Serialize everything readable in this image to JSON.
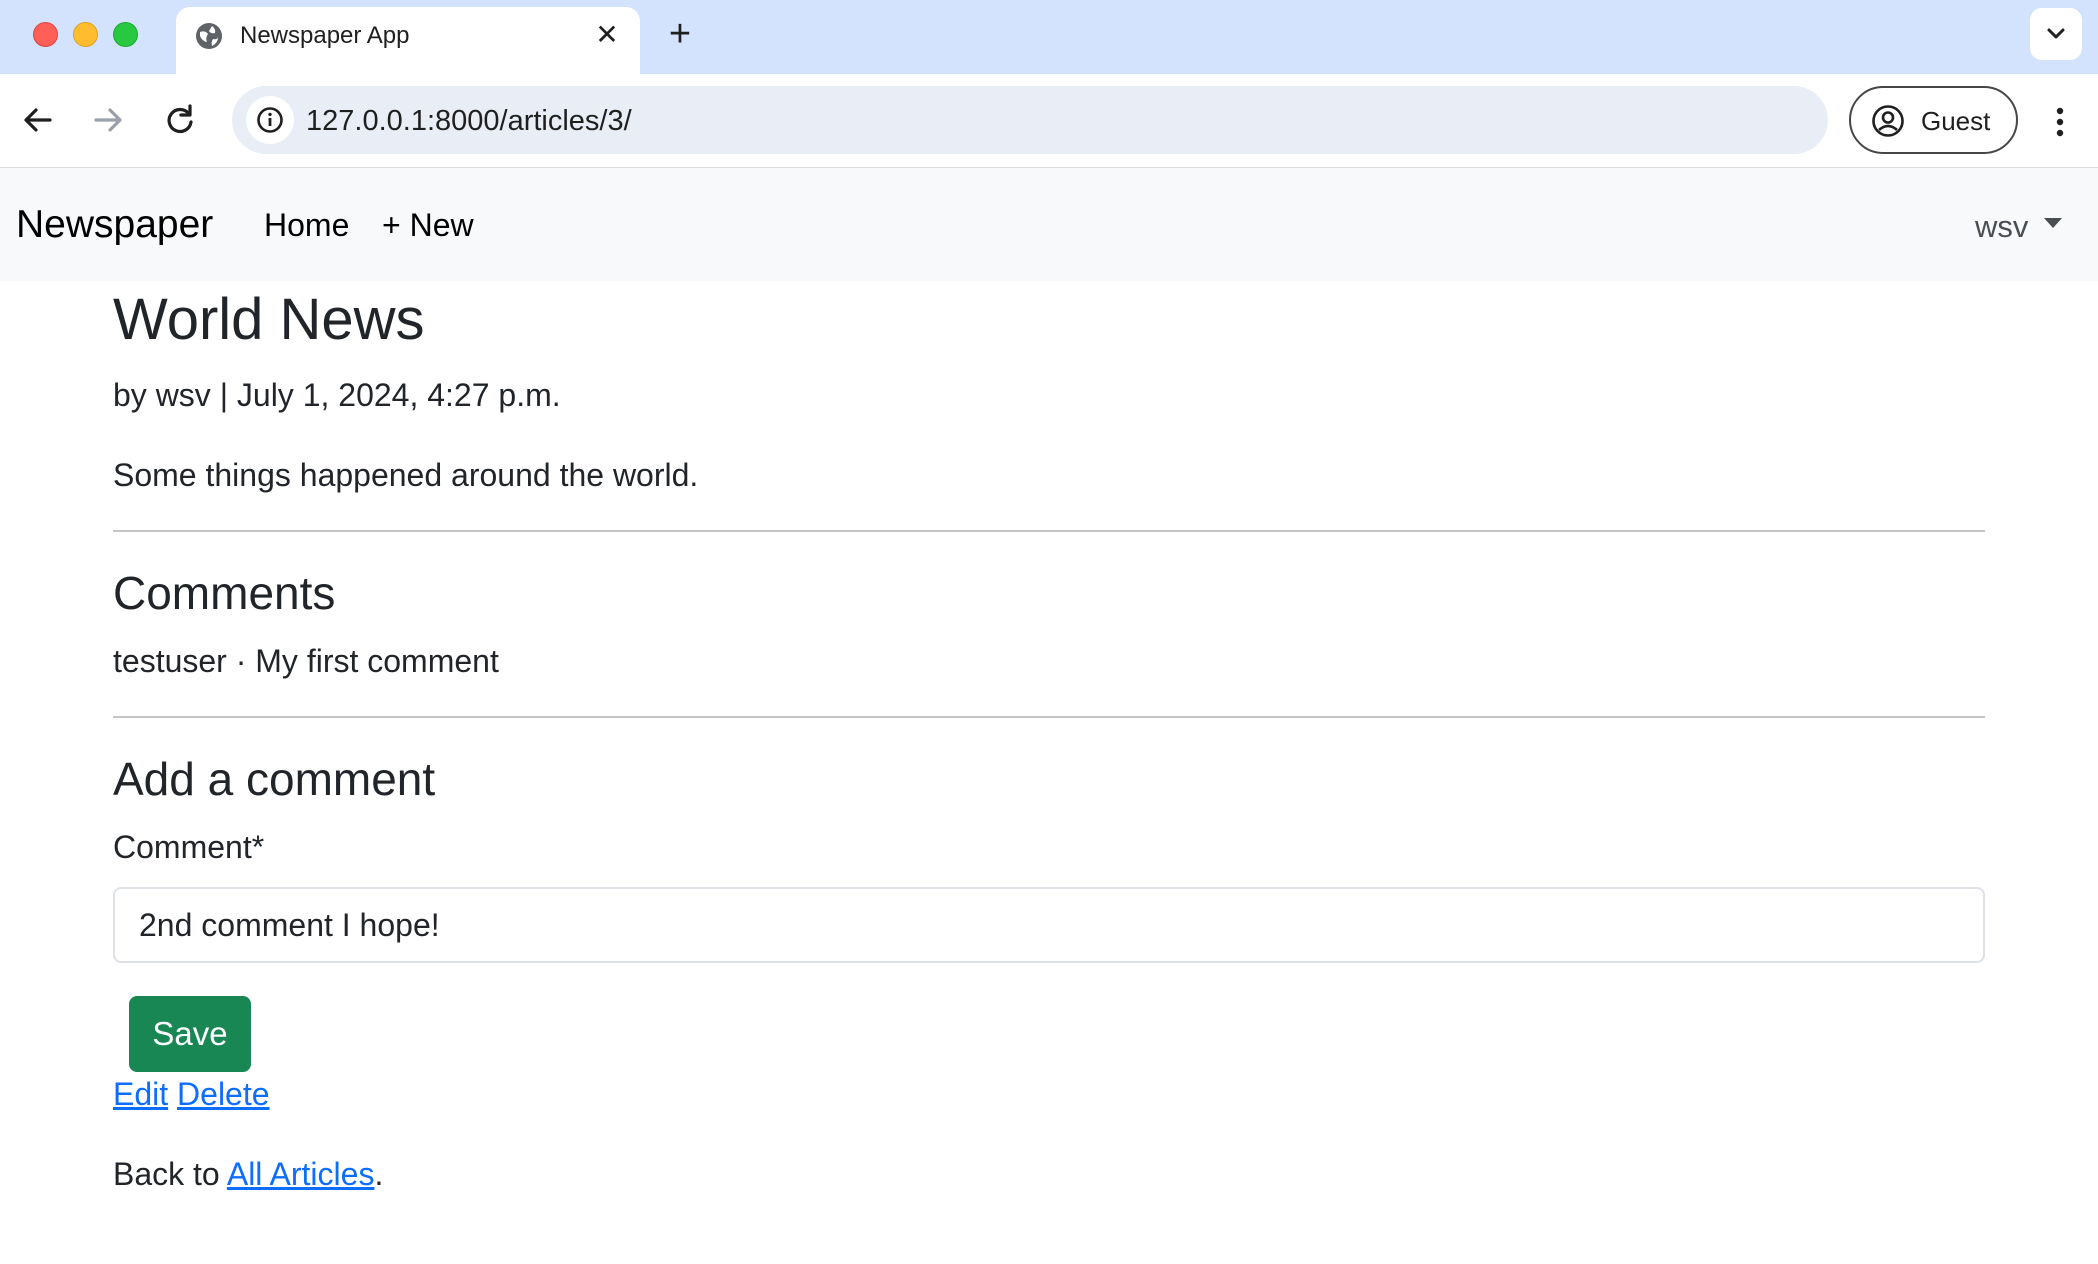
{
  "browser": {
    "tab_title": "Newspaper App",
    "url": "127.0.0.1:8000/articles/3/",
    "profile_label": "Guest"
  },
  "navbar": {
    "brand": "Newspaper",
    "home": "Home",
    "new": "+ New",
    "user": "wsv"
  },
  "article": {
    "title": "World News",
    "byline": "by wsv | July 1, 2024, 4:27 p.m.",
    "body": "Some things happened around the world."
  },
  "comments": {
    "heading": "Comments",
    "items": [
      {
        "text": "testuser · My first comment"
      }
    ]
  },
  "add_comment": {
    "heading": "Add a comment",
    "label": "Comment*",
    "value": "2nd comment I hope!",
    "save_label": "Save"
  },
  "actions": {
    "edit": "Edit",
    "delete": "Delete"
  },
  "footer": {
    "back_prefix": "Back to ",
    "back_link": "All Articles",
    "back_suffix": "."
  },
  "colors": {
    "tabstrip": "#d3e3fd",
    "navbar_bg": "#f8f9fa",
    "save_button": "#198754",
    "link": "#0d6efd"
  }
}
